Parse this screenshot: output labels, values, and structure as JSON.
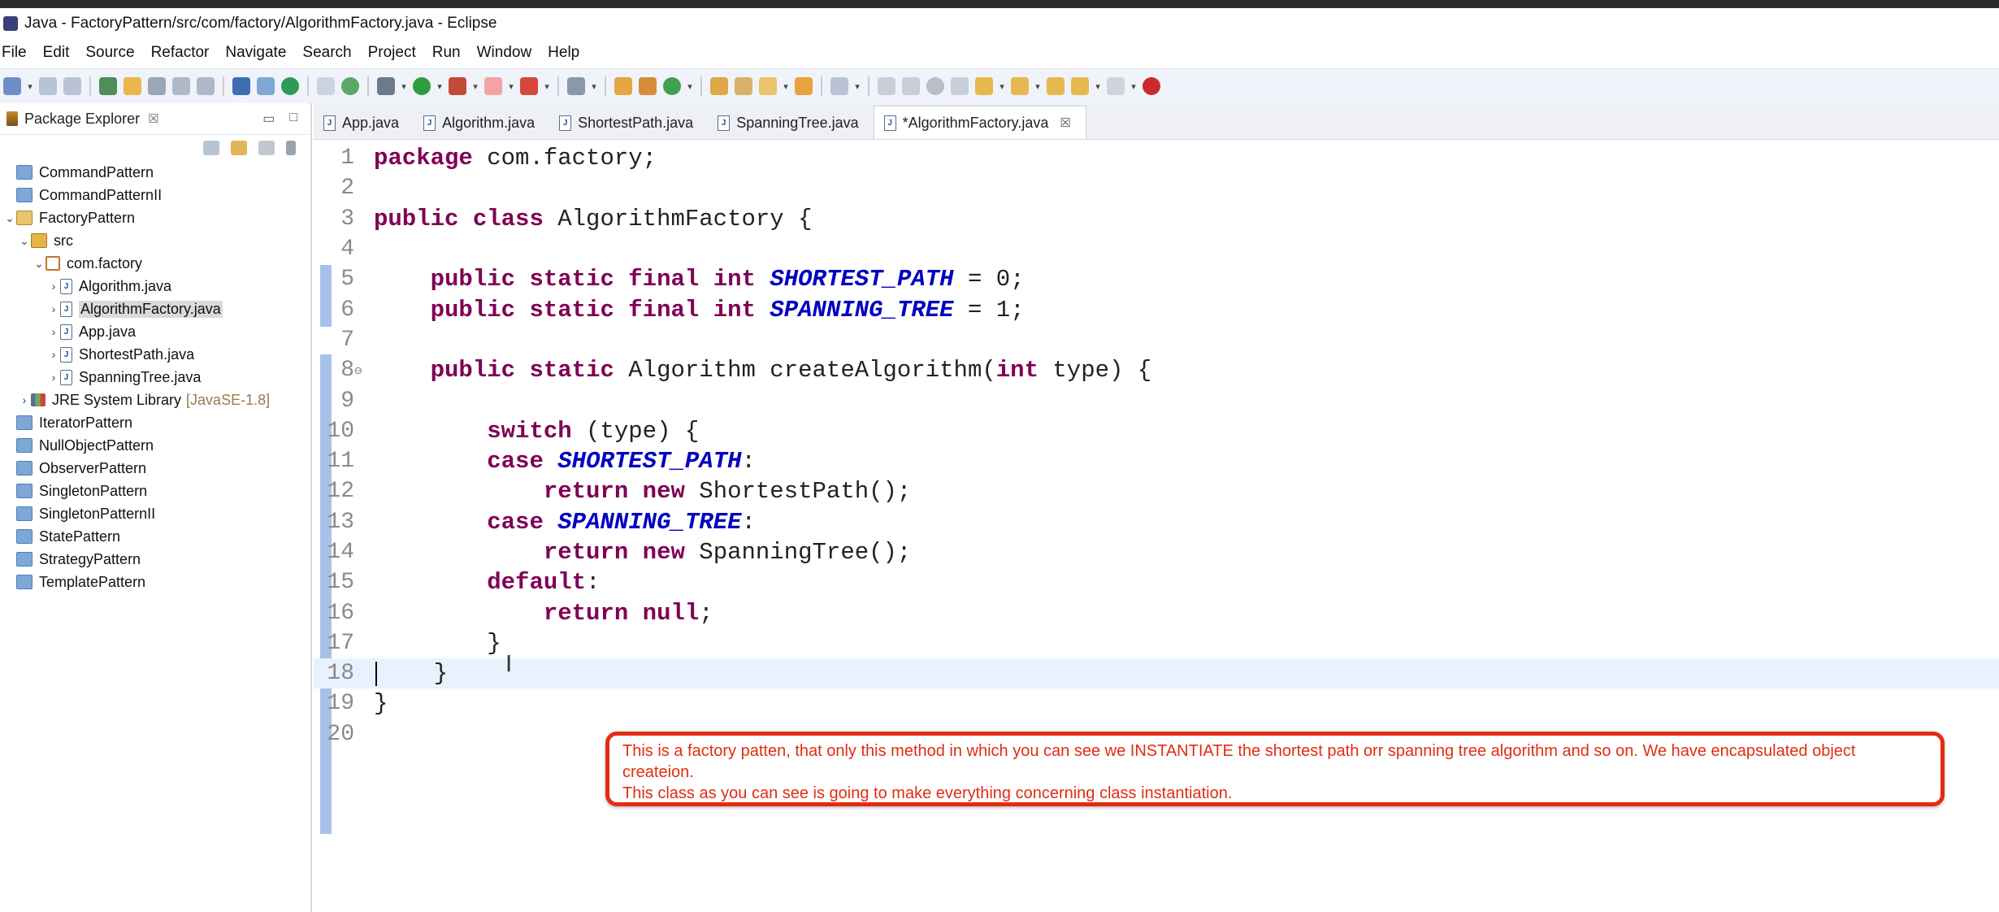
{
  "window": {
    "title": "Java - FactoryPattern/src/com/factory/AlgorithmFactory.java - Eclipse"
  },
  "menubar": [
    "File",
    "Edit",
    "Source",
    "Refactor",
    "Navigate",
    "Search",
    "Project",
    "Run",
    "Window",
    "Help"
  ],
  "package_explorer": {
    "title": "Package Explorer",
    "tree": [
      {
        "label": "CommandPattern",
        "level": 0,
        "icon": "folder-icon",
        "twisty": ""
      },
      {
        "label": "CommandPatternII",
        "level": 0,
        "icon": "folder-icon",
        "twisty": ""
      },
      {
        "label": "FactoryPattern",
        "level": 0,
        "icon": "open-folder-icon",
        "twisty": "v"
      },
      {
        "label": "src",
        "level": 1,
        "icon": "src-icon",
        "twisty": "v"
      },
      {
        "label": "com.factory",
        "level": 2,
        "icon": "pkg-icon",
        "twisty": "v"
      },
      {
        "label": "Algorithm.java",
        "level": 3,
        "icon": "java-icon",
        "twisty": ">"
      },
      {
        "label": "AlgorithmFactory.java",
        "level": 3,
        "icon": "java-icon",
        "twisty": ">",
        "selected": true
      },
      {
        "label": "App.java",
        "level": 3,
        "icon": "java-icon",
        "twisty": ">"
      },
      {
        "label": "ShortestPath.java",
        "level": 3,
        "icon": "java-icon",
        "twisty": ">"
      },
      {
        "label": "SpanningTree.java",
        "level": 3,
        "icon": "java-icon",
        "twisty": ">"
      },
      {
        "label": "JRE System Library",
        "suffix": "[JavaSE-1.8]",
        "level": 1,
        "icon": "lib-icon",
        "twisty": ">"
      },
      {
        "label": "IteratorPattern",
        "level": 0,
        "icon": "folder-icon",
        "twisty": ""
      },
      {
        "label": "NullObjectPattern",
        "level": 0,
        "icon": "folder-icon",
        "twisty": ""
      },
      {
        "label": "ObserverPattern",
        "level": 0,
        "icon": "folder-icon",
        "twisty": ""
      },
      {
        "label": "SingletonPattern",
        "level": 0,
        "icon": "folder-icon",
        "twisty": ""
      },
      {
        "label": "SingletonPatternII",
        "level": 0,
        "icon": "folder-icon",
        "twisty": ""
      },
      {
        "label": "StatePattern",
        "level": 0,
        "icon": "folder-icon",
        "twisty": ""
      },
      {
        "label": "StrategyPattern",
        "level": 0,
        "icon": "folder-icon",
        "twisty": ""
      },
      {
        "label": "TemplatePattern",
        "level": 0,
        "icon": "folder-icon",
        "twisty": ""
      }
    ]
  },
  "editor_tabs": [
    {
      "label": "App.java",
      "active": false
    },
    {
      "label": "Algorithm.java",
      "active": false
    },
    {
      "label": "ShortestPath.java",
      "active": false
    },
    {
      "label": "SpanningTree.java",
      "active": false
    },
    {
      "label": "*AlgorithmFactory.java",
      "active": true
    }
  ],
  "code": [
    [
      {
        "t": "kw",
        "v": "package"
      },
      {
        "t": "txt",
        "v": " com.factory;"
      }
    ],
    [],
    [
      {
        "t": "kw",
        "v": "public"
      },
      {
        "t": "txt",
        "v": " "
      },
      {
        "t": "kw",
        "v": "class"
      },
      {
        "t": "txt",
        "v": " AlgorithmFactory {"
      }
    ],
    [],
    [
      {
        "t": "txt",
        "v": "    "
      },
      {
        "t": "kw",
        "v": "public"
      },
      {
        "t": "txt",
        "v": " "
      },
      {
        "t": "kw",
        "v": "static"
      },
      {
        "t": "txt",
        "v": " "
      },
      {
        "t": "kw",
        "v": "final"
      },
      {
        "t": "txt",
        "v": " "
      },
      {
        "t": "kw",
        "v": "int"
      },
      {
        "t": "txt",
        "v": " "
      },
      {
        "t": "const",
        "v": "SHORTEST_PATH"
      },
      {
        "t": "txt",
        "v": " = 0;"
      }
    ],
    [
      {
        "t": "txt",
        "v": "    "
      },
      {
        "t": "kw",
        "v": "public"
      },
      {
        "t": "txt",
        "v": " "
      },
      {
        "t": "kw",
        "v": "static"
      },
      {
        "t": "txt",
        "v": " "
      },
      {
        "t": "kw",
        "v": "final"
      },
      {
        "t": "txt",
        "v": " "
      },
      {
        "t": "kw",
        "v": "int"
      },
      {
        "t": "txt",
        "v": " "
      },
      {
        "t": "const",
        "v": "SPANNING_TREE"
      },
      {
        "t": "txt",
        "v": " = 1;"
      }
    ],
    [],
    [
      {
        "t": "txt",
        "v": "    "
      },
      {
        "t": "kw",
        "v": "public"
      },
      {
        "t": "txt",
        "v": " "
      },
      {
        "t": "kw",
        "v": "static"
      },
      {
        "t": "txt",
        "v": " Algorithm createAlgorithm("
      },
      {
        "t": "kw",
        "v": "int"
      },
      {
        "t": "txt",
        "v": " type) {"
      }
    ],
    [],
    [
      {
        "t": "txt",
        "v": "        "
      },
      {
        "t": "kw",
        "v": "switch"
      },
      {
        "t": "txt",
        "v": " (type) {"
      }
    ],
    [
      {
        "t": "txt",
        "v": "        "
      },
      {
        "t": "kw",
        "v": "case"
      },
      {
        "t": "txt",
        "v": " "
      },
      {
        "t": "const",
        "v": "SHORTEST_PATH"
      },
      {
        "t": "txt",
        "v": ":"
      }
    ],
    [
      {
        "t": "txt",
        "v": "            "
      },
      {
        "t": "kw",
        "v": "return"
      },
      {
        "t": "txt",
        "v": " "
      },
      {
        "t": "kw",
        "v": "new"
      },
      {
        "t": "txt",
        "v": " ShortestPath();"
      }
    ],
    [
      {
        "t": "txt",
        "v": "        "
      },
      {
        "t": "kw",
        "v": "case"
      },
      {
        "t": "txt",
        "v": " "
      },
      {
        "t": "const",
        "v": "SPANNING_TREE"
      },
      {
        "t": "txt",
        "v": ":"
      }
    ],
    [
      {
        "t": "txt",
        "v": "            "
      },
      {
        "t": "kw",
        "v": "return"
      },
      {
        "t": "txt",
        "v": " "
      },
      {
        "t": "kw",
        "v": "new"
      },
      {
        "t": "txt",
        "v": " SpanningTree();"
      }
    ],
    [
      {
        "t": "txt",
        "v": "        "
      },
      {
        "t": "kw",
        "v": "default"
      },
      {
        "t": "txt",
        "v": ":"
      }
    ],
    [
      {
        "t": "txt",
        "v": "            "
      },
      {
        "t": "kw",
        "v": "return"
      },
      {
        "t": "txt",
        "v": " "
      },
      {
        "t": "kw",
        "v": "null"
      },
      {
        "t": "txt",
        "v": ";"
      }
    ],
    [
      {
        "t": "txt",
        "v": "        }"
      }
    ],
    [
      {
        "t": "txt",
        "v": "    }"
      }
    ],
    [
      {
        "t": "txt",
        "v": "}"
      }
    ],
    []
  ],
  "annotation": {
    "line1": "This is a factory patten, that only this method in which you can see we INSTANTIATE the shortest path orr spanning tree algorithm and so on. We have encapsulated object createion.",
    "line2": "This class as you can see is going to make everything concerning class instantiation."
  }
}
